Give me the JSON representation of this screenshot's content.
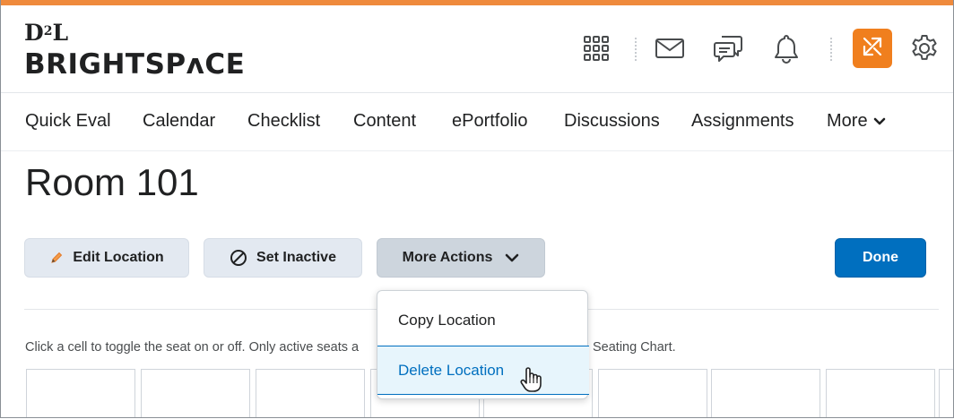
{
  "brand": {
    "logo_top_a": "D",
    "logo_top_b": "2",
    "logo_top_c": "L",
    "logo_bottom": "BRIGHTSPʌCE",
    "colors": {
      "accent": "#ef8a3c",
      "primary": "#006fbf",
      "switch": "#f07f1e"
    }
  },
  "header_icons": [
    "waffle-grid-icon",
    "mail-icon",
    "chat-icon",
    "bell-icon",
    "role-switch-icon",
    "gear-icon"
  ],
  "nav": {
    "items": [
      "Quick Eval",
      "Calendar",
      "Checklist",
      "Content",
      "ePortfolio",
      "Discussions",
      "Assignments"
    ],
    "more_label": "More"
  },
  "page": {
    "title": "Room 101",
    "buttons": {
      "edit": "Edit Location",
      "inactive": "Set Inactive",
      "more_actions": "More Actions",
      "done": "Done"
    },
    "info_text": "Click a cell to toggle the seat on or off. Only active seats a",
    "info_tail": "Seating Chart."
  },
  "dropdown": {
    "items": [
      "Copy Location",
      "Delete Location"
    ],
    "hovered": "Delete Location"
  }
}
